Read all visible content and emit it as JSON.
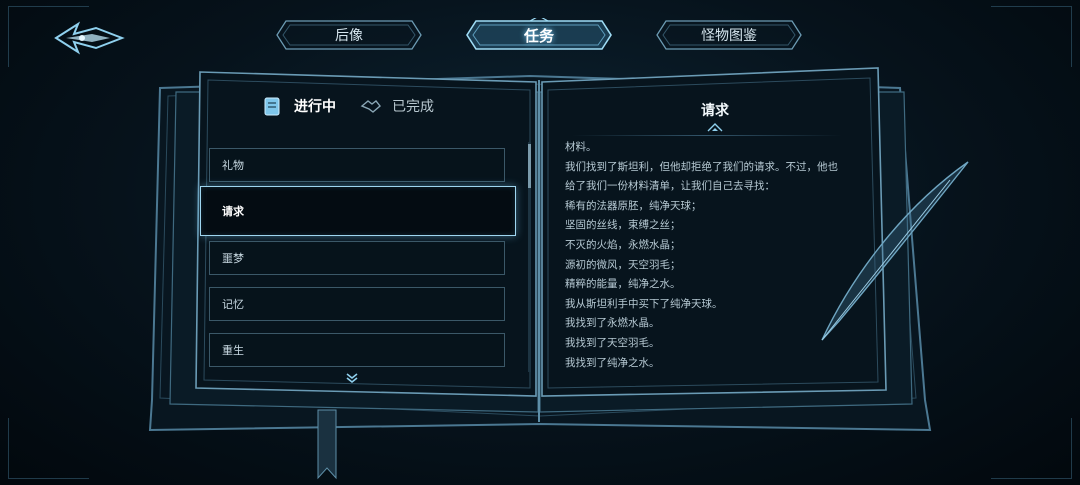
{
  "top_tabs": [
    {
      "label": "后像",
      "active": false
    },
    {
      "label": "任务",
      "active": true
    },
    {
      "label": "怪物图鉴",
      "active": false
    }
  ],
  "status_tabs": {
    "in_progress": {
      "label": "进行中",
      "icon": "scroll-icon",
      "active": true
    },
    "completed": {
      "label": "已完成",
      "icon": "handshake-icon",
      "active": false
    }
  },
  "quests": [
    {
      "label": "礼物"
    },
    {
      "label": "请求",
      "selected": true
    },
    {
      "label": "噩梦"
    },
    {
      "label": "记忆"
    },
    {
      "label": "重生"
    }
  ],
  "detail": {
    "title": "请求",
    "lines": [
      "材料。",
      "我们找到了斯坦利，但他却拒绝了我们的请求。不过，他也",
      "给了我们一份材料清单，让我们自己去寻找：",
      "稀有的法器原胚，纯净天球；",
      "坚固的丝线，束缚之丝；",
      "不灭的火焰，永燃水晶；",
      "源初的微风，天空羽毛；",
      "精粹的能量，纯净之水。",
      "我从斯坦利手中买下了纯净天球。",
      "我找到了永燃水晶。",
      "我找到了天空羽毛。",
      "我找到了纯净之水。"
    ]
  },
  "colors": {
    "accent": "#7fd3ff",
    "frame": "#5a8aa3",
    "background": "#06121b"
  }
}
